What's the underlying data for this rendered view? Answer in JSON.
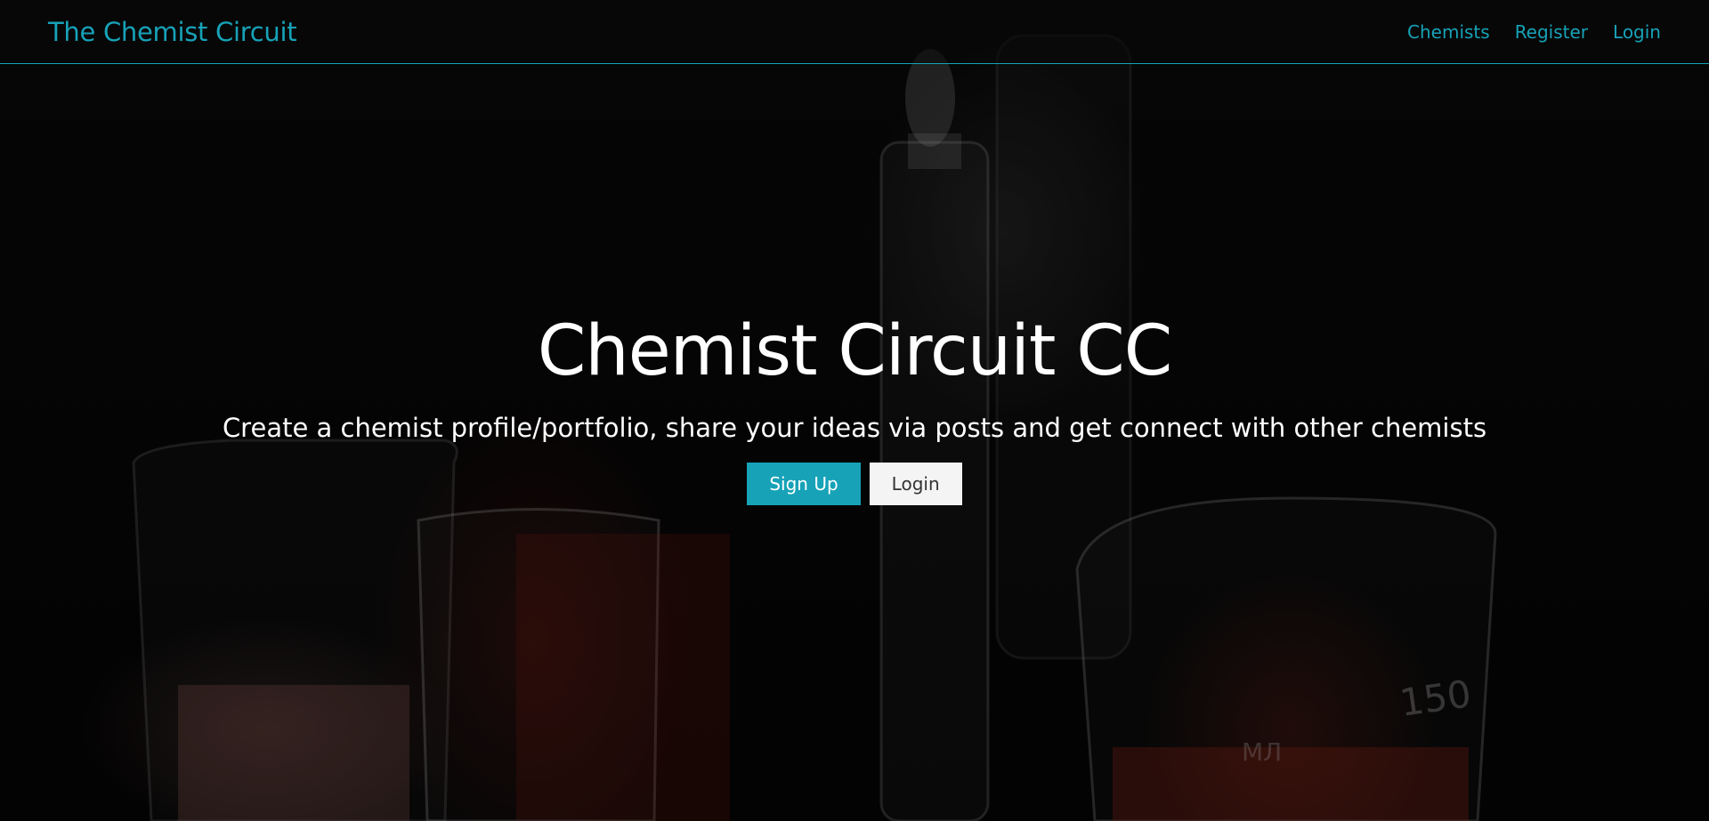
{
  "navbar": {
    "brand": "The Chemist Circuit",
    "links": [
      {
        "label": "Chemists"
      },
      {
        "label": "Register"
      },
      {
        "label": "Login"
      }
    ]
  },
  "hero": {
    "title": "Chemist Circuit CC",
    "lead": "Create a chemist profile/portfolio, share your ideas via posts and get connect with other chemists",
    "buttons": {
      "signup_label": "Sign Up",
      "login_label": "Login"
    }
  },
  "colors": {
    "accent": "#17a2b8",
    "background": "#060606",
    "light_button": "#f4f4f4"
  },
  "background_image": {
    "subject": "dark lab glassware photo",
    "beaker_label": "150",
    "beaker_mark": "МЛ"
  }
}
